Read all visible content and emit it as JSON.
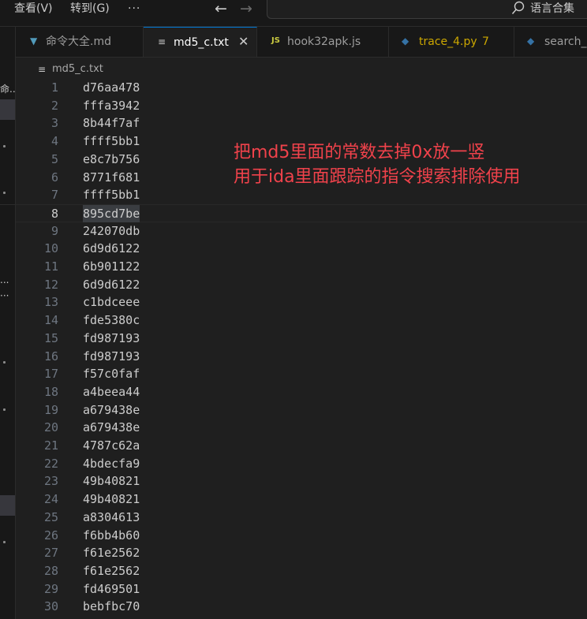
{
  "titlebar": {
    "menus": [
      "查看(V)",
      "转到(G)",
      "···"
    ],
    "search_label": "语言合集"
  },
  "sidebar": {
    "fragments": [
      "命...",
      "...",
      "···"
    ]
  },
  "tabs": [
    {
      "label": "命令大全.md",
      "icon": "markdown-icon",
      "active": false
    },
    {
      "label": "md5_c.txt",
      "icon": "text-file-icon",
      "active": true
    },
    {
      "label": "hook32apk.js",
      "icon": "js-icon",
      "active": false
    },
    {
      "label": "trace_4.py",
      "badge": "7",
      "icon": "python-icon",
      "active": false
    },
    {
      "label": "search_",
      "icon": "python-icon",
      "active": false
    }
  ],
  "breadcrumb": {
    "file": "md5_c.txt"
  },
  "editor": {
    "current_line": 8,
    "lines": [
      {
        "n": "1",
        "text": "d76aa478"
      },
      {
        "n": "2",
        "text": "fffa3942"
      },
      {
        "n": "3",
        "text": "8b44f7af"
      },
      {
        "n": "4",
        "text": "ffff5bb1"
      },
      {
        "n": "5",
        "text": "e8c7b756"
      },
      {
        "n": "6",
        "text": "8771f681"
      },
      {
        "n": "7",
        "text": "ffff5bb1"
      },
      {
        "n": "8",
        "text": "895cd7be"
      },
      {
        "n": "9",
        "text": "242070db"
      },
      {
        "n": "10",
        "text": "6d9d6122"
      },
      {
        "n": "11",
        "text": "6b901122"
      },
      {
        "n": "12",
        "text": "6d9d6122"
      },
      {
        "n": "13",
        "text": "c1bdceee"
      },
      {
        "n": "14",
        "text": "fde5380c"
      },
      {
        "n": "15",
        "text": "fd987193"
      },
      {
        "n": "16",
        "text": "fd987193"
      },
      {
        "n": "17",
        "text": "f57c0faf"
      },
      {
        "n": "18",
        "text": "a4beea44"
      },
      {
        "n": "19",
        "text": "a679438e"
      },
      {
        "n": "20",
        "text": "a679438e"
      },
      {
        "n": "21",
        "text": "4787c62a"
      },
      {
        "n": "22",
        "text": "4bdecfa9"
      },
      {
        "n": "23",
        "text": "49b40821"
      },
      {
        "n": "24",
        "text": "49b40821"
      },
      {
        "n": "25",
        "text": "a8304613"
      },
      {
        "n": "26",
        "text": "f6bb4b60"
      },
      {
        "n": "27",
        "text": "f61e2562"
      },
      {
        "n": "28",
        "text": "f61e2562"
      },
      {
        "n": "29",
        "text": "fd469501"
      },
      {
        "n": "30",
        "text": "bebfbc70"
      }
    ]
  },
  "annotation": {
    "line1": "把md5里面的常数去掉0x放一竖",
    "line2": "用于ida里面跟踪的指令搜索排除使用",
    "color": "#f0424b"
  },
  "colors": {
    "accent": "#0078d4",
    "python": "#3572a5",
    "javascript": "#cbcb41",
    "markdown": "#519aba",
    "warning": "#cca700"
  }
}
